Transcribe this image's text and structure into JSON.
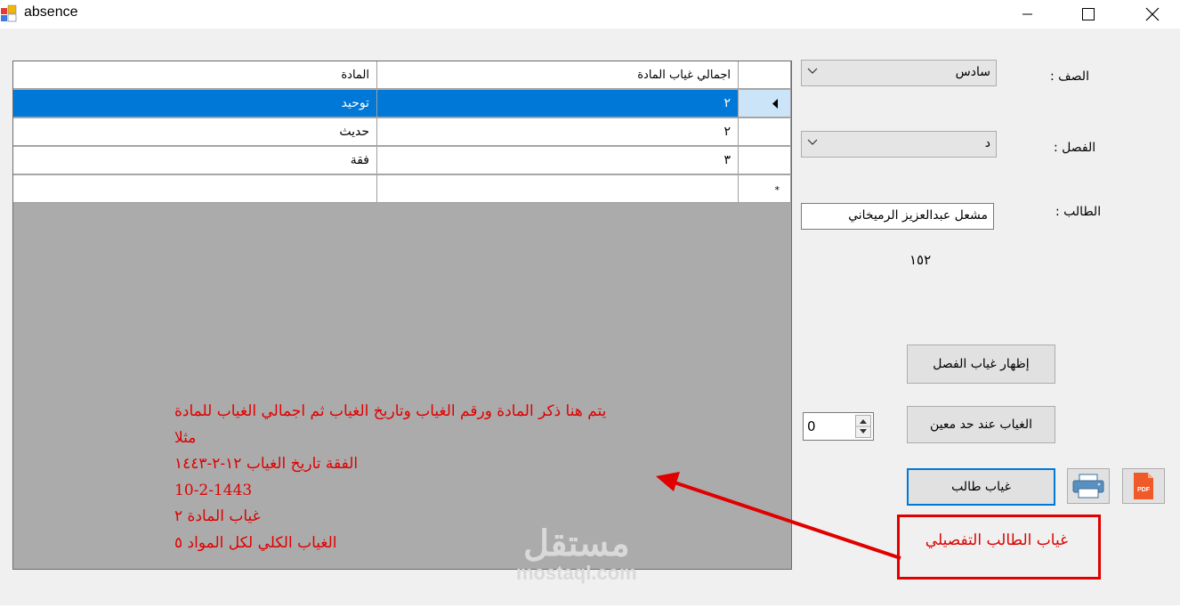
{
  "window": {
    "title": "absence"
  },
  "grid": {
    "headers": {
      "subject": "المادة",
      "total": "اجمالي غياب المادة"
    },
    "rows": [
      {
        "subject": "توحيد",
        "total": "٢"
      },
      {
        "subject": "حديث",
        "total": "٢"
      },
      {
        "subject": "فقة",
        "total": "٣"
      }
    ],
    "new_row_marker": "*"
  },
  "form": {
    "class_label": "الصف :",
    "class_value": "سادس",
    "section_label": "الفصل :",
    "section_value": "د",
    "student_label": "الطالب :",
    "student_value": "مشعل عبدالعزيز الرميخاني",
    "student_id": "١٥٢",
    "threshold_value": "0"
  },
  "buttons": {
    "show_class_absence": "إظهار  غياب  الفصل",
    "absence_threshold": "الغياب عند حد معين",
    "student_absence": "غياب طالب",
    "pdf_label": "PDF"
  },
  "annotation": {
    "lines": [
      "يتم هنا ذكر المادة ورقم الغياب وتاريخ الغياب ثم اجمالي الغياب للمادة",
      "مثلا",
      "الفقة   تاريخ الغياب ١٢-٢-١٤٤٣",
      "10-2-1443",
      "غياب المادة ٢",
      "الغياب الكلي لكل المواد ٥"
    ],
    "callout_text": "غياب الطالب التفصيلي"
  },
  "watermark": {
    "arabic": "مستقل",
    "latin": "mostaql.com"
  },
  "colors": {
    "selection": "#0078d7",
    "annotation": "#e00000",
    "grid_bg": "#ababab"
  }
}
